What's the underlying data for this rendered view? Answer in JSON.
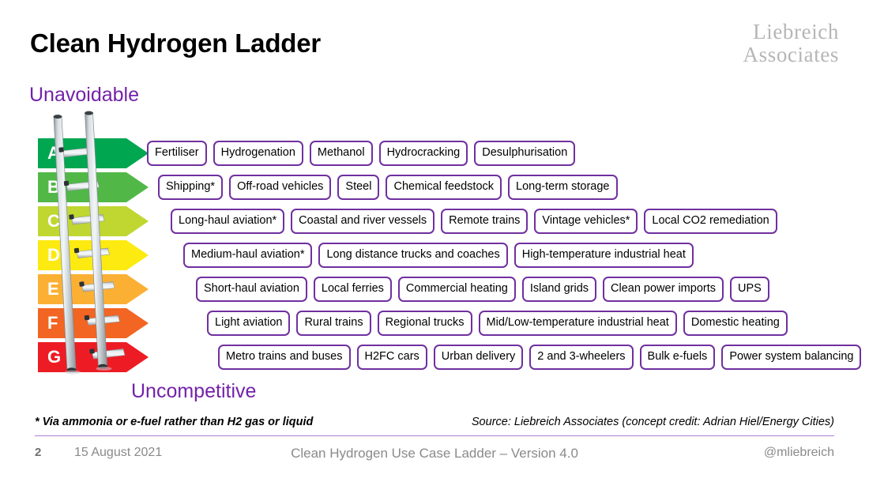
{
  "header": {
    "title": "Clean Hydrogen Ladder",
    "logo_line1": "Liebreich",
    "logo_line2": "Associates"
  },
  "axis": {
    "top_label": "Unavoidable",
    "bottom_label": "Uncompetitive",
    "accent_color": "#7322a8"
  },
  "ladder": {
    "rows": [
      {
        "grade": "A",
        "color": "#00a650",
        "items": [
          "Fertiliser",
          "Hydrogenation",
          "Methanol",
          "Hydrocracking",
          "Desulphurisation"
        ]
      },
      {
        "grade": "B",
        "color": "#51b848",
        "items": [
          "Shipping*",
          "Off-road vehicles",
          "Steel",
          "Chemical feedstock",
          "Long-term storage"
        ]
      },
      {
        "grade": "C",
        "color": "#bfd730",
        "items": [
          "Long-haul aviation*",
          "Coastal and river vessels",
          "Remote trains",
          "Vintage vehicles*",
          "Local CO2 remediation"
        ]
      },
      {
        "grade": "D",
        "color": "#fcea10",
        "items": [
          "Medium-haul aviation*",
          "Long distance trucks and coaches",
          "High-temperature industrial heat"
        ]
      },
      {
        "grade": "E",
        "color": "#fbb034",
        "items": [
          "Short-haul aviation",
          "Local ferries",
          "Commercial heating",
          "Island grids",
          "Clean power imports",
          "UPS"
        ]
      },
      {
        "grade": "F",
        "color": "#f26522",
        "items": [
          "Light aviation",
          "Rural trains",
          "Regional trucks",
          "Mid/Low-temperature industrial heat",
          "Domestic heating"
        ]
      },
      {
        "grade": "G",
        "color": "#ed1c24",
        "items": [
          "Metro trains and buses",
          "H2FC cars",
          "Urban delivery",
          "2 and 3-wheelers",
          "Bulk e-fuels",
          "Power system balancing"
        ]
      }
    ],
    "pill_border_color": "#7030a0"
  },
  "notes": {
    "footnote": "* Via ammonia or e-fuel rather than H2 gas or liquid",
    "source": "Source: Liebreich Associates (concept credit: Adrian Hiel/Energy Cities)"
  },
  "footer": {
    "page_number": "2",
    "date": "15 August 2021",
    "center": "Clean Hydrogen Use Case Ladder – Version 4.0",
    "handle": "@mliebreich"
  }
}
